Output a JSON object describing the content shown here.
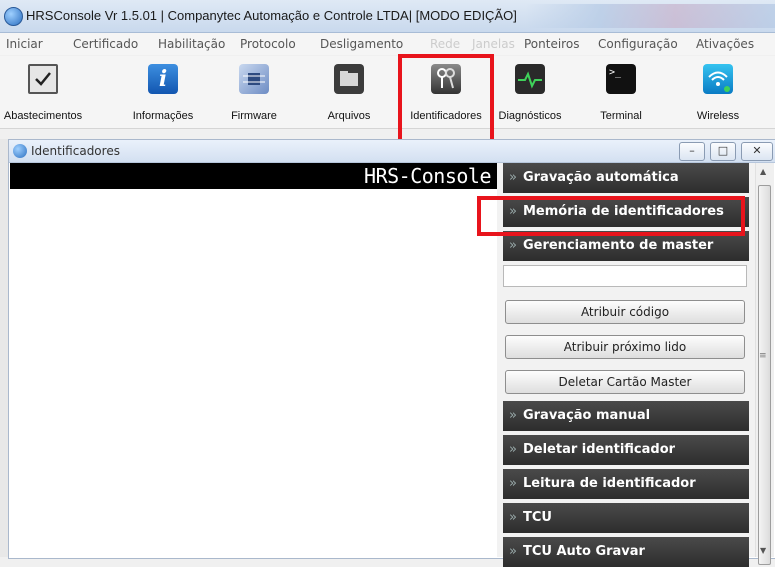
{
  "window": {
    "title": "HRSConsole Vr 1.5.01  |  Companytec Automação e Controle LTDA| [MODO EDIÇÃO]"
  },
  "menu": [
    "Iniciar",
    "Certificado",
    "Habilitação",
    "Protocolo",
    "Desligamento",
    "Rede",
    "Janelas",
    "Ponteiros",
    "Configuração",
    "Ativações"
  ],
  "toolbar": [
    "Abastecimentos",
    "Informações",
    "Firmware",
    "Arquivos",
    "Identificadores",
    "Diagnósticos",
    "Terminal",
    "Wireless"
  ],
  "child_window": {
    "title": "Identificadores",
    "min": "–",
    "max": "□",
    "close": "✕"
  },
  "banner": "HRS-Console",
  "panel": {
    "sections": [
      "Gravação automática",
      "Memória de identificadores",
      "Gerenciamento de master",
      "Gravação manual",
      "Deletar identificador",
      "Leitura de identificador",
      "TCU",
      "TCU Auto Gravar"
    ],
    "input_value": "",
    "buttons": [
      "Atribuir código",
      "Atribuir próximo lido",
      "Deletar Cartão Master"
    ]
  },
  "colors": {
    "highlight": "#e8141c",
    "section_bg": "#333333"
  }
}
